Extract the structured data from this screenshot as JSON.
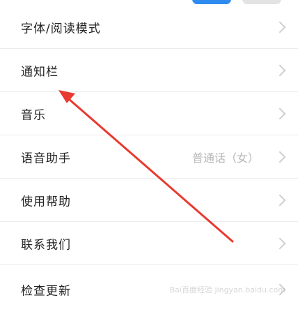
{
  "top_controls": {
    "accent": "#2f8bf0",
    "muted": "#e3e3e3"
  },
  "rows": [
    {
      "label": "字体/阅读模式",
      "value": ""
    },
    {
      "label": "通知栏",
      "value": ""
    },
    {
      "label": "音乐",
      "value": ""
    },
    {
      "label": "语音助手",
      "value": "普通话（女）"
    },
    {
      "label": "使用帮助",
      "value": ""
    },
    {
      "label": "联系我们",
      "value": ""
    },
    {
      "label": "检查更新",
      "value": ""
    }
  ],
  "annotation": {
    "arrow_color": "#e83a2e",
    "points_to": "通知栏"
  },
  "watermark": "Bai百度经验 jingyan.baidu.com"
}
